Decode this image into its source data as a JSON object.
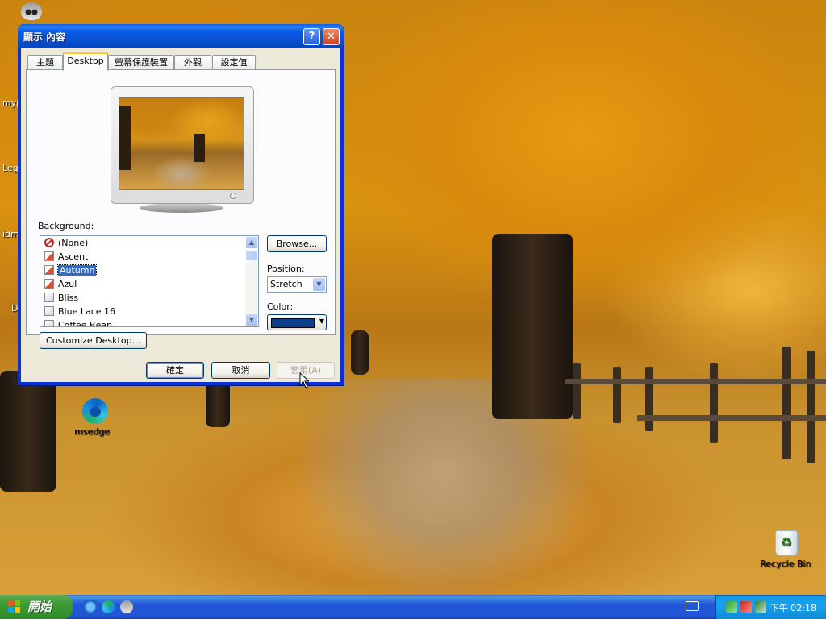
{
  "desktop": {
    "icons": [
      {
        "label": "msedge"
      },
      {
        "label": "Recycle Bin"
      }
    ],
    "clipped_labels": [
      "myp",
      "Leg",
      "idm",
      "D"
    ]
  },
  "dialog": {
    "title": "顯示 內容",
    "help_glyph": "?",
    "close_glyph": "✕",
    "tabs": [
      {
        "label": "主題"
      },
      {
        "label": "Desktop"
      },
      {
        "label": "螢幕保護裝置"
      },
      {
        "label": "外觀"
      },
      {
        "label": "設定值"
      }
    ],
    "active_tab": "Desktop",
    "background_label": "Background:",
    "background_items": [
      {
        "label": "(None)",
        "icon": "none-icon"
      },
      {
        "label": "Ascent",
        "icon": "jpg-file-icon"
      },
      {
        "label": "Autumn",
        "icon": "jpg-file-icon",
        "selected": true
      },
      {
        "label": "Azul",
        "icon": "jpg-file-icon"
      },
      {
        "label": "Bliss",
        "icon": "bmp-file-icon"
      },
      {
        "label": "Blue Lace 16",
        "icon": "bmp-file-icon"
      },
      {
        "label": "Coffee Bean",
        "icon": "bmp-file-icon"
      }
    ],
    "browse_label": "Browse...",
    "position_label": "Position:",
    "position_value": "Stretch",
    "color_label": "Color:",
    "color_value": "#0a3f8c",
    "customize_label": "Customize Desktop...",
    "ok_label": "確定",
    "cancel_label": "取消",
    "apply_label": "套用(A)"
  },
  "taskbar": {
    "start_label": "開始",
    "clock": "下午 02:18",
    "quick_launch": [
      "ie-icon",
      "edge-icon",
      "raccoon-icon"
    ],
    "tray_icons": [
      "network-icon",
      "security-shield-icon",
      "safely-remove-icon"
    ]
  },
  "colors": {
    "title_bar": "#0a5be8",
    "taskbar": "#2157d7",
    "start": "#3c9b35",
    "selection": "#316ac5"
  }
}
